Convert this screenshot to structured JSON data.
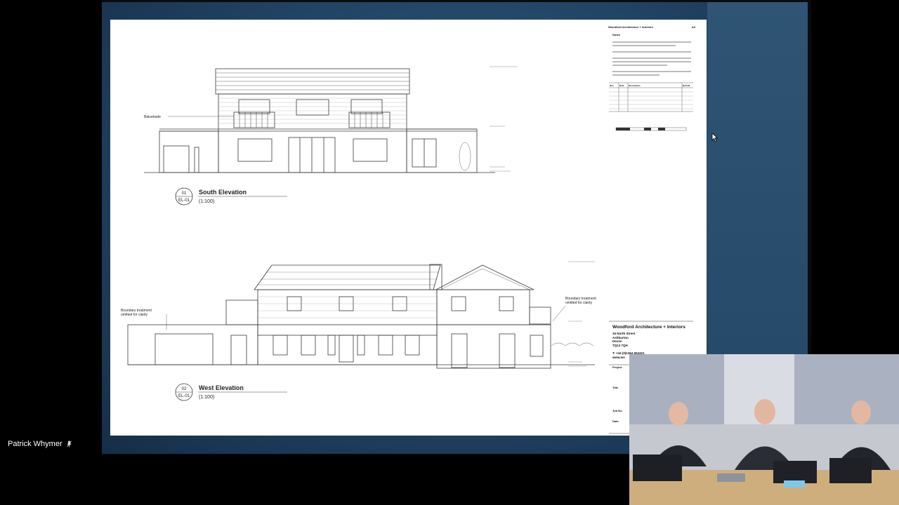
{
  "participant": {
    "name": "Patrick Whymer",
    "mic_icon": "mic-muted-icon"
  },
  "drawing": {
    "south": {
      "number": "01",
      "sheet_ref": "EL-01",
      "title": "South Elevation",
      "scale": "(1:100)",
      "note": "Balustrade"
    },
    "west": {
      "number": "02",
      "sheet_ref": "EL-01",
      "title": "West Elevation",
      "scale": "(1:100)",
      "note_left": "Boundary treatment\nomitted for clarity",
      "note_right": "Boundary treatment\nomitted for clarity"
    }
  },
  "title_block": {
    "header": "Woodford Architecture + Interiors",
    "sheet_size": "A3",
    "notes_heading": "Notes",
    "firm": "Woodford Architecture + Interiors",
    "address": [
      "15 North Street",
      "Ashburton",
      "Devon",
      "TQ13 7QH"
    ],
    "phone": "T: +44 (0)1364 654321",
    "web": "www.wo",
    "project_label": "Project",
    "title_label": "Title",
    "job_label": "Job No.",
    "date_label": "Date",
    "rev_headers": [
      "Rev.",
      "Date",
      "Description",
      "By/Chk"
    ]
  },
  "colors": {
    "paper": "#ffffff",
    "line": "#3a3a3a",
    "background": "#24486a"
  }
}
